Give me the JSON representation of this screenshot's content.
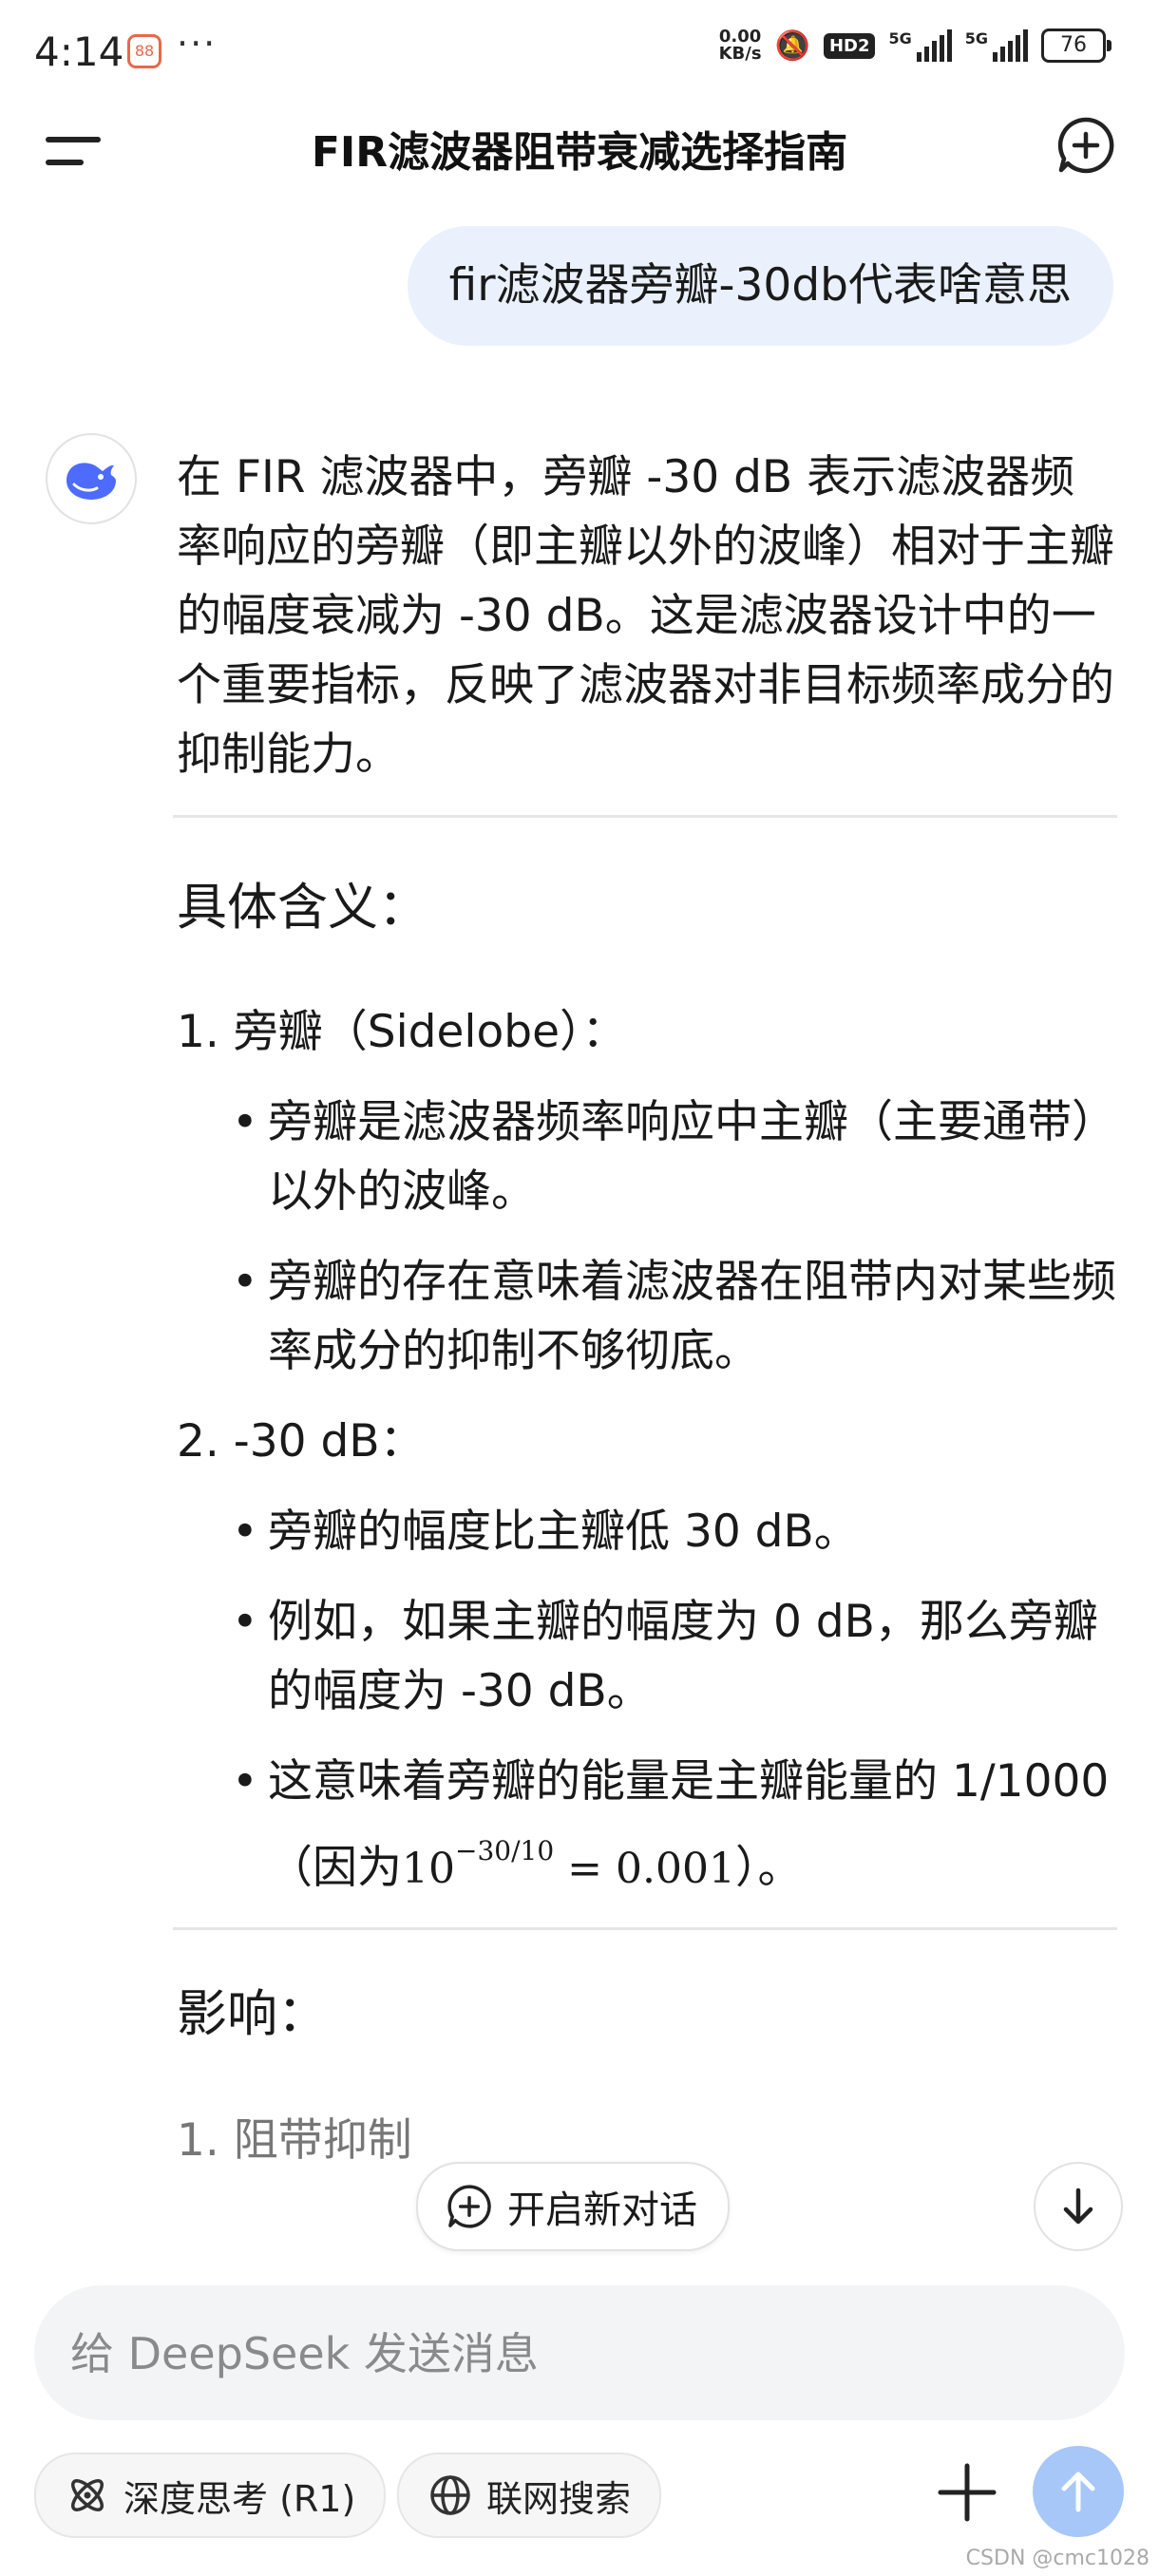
{
  "status_bar": {
    "time": "4:14",
    "app_badge": "88",
    "more": "···",
    "speed_value": "0.00",
    "speed_unit": "KB/s",
    "hd": "HD2",
    "net1": "5G",
    "net2": "5G",
    "battery": "76"
  },
  "header": {
    "title": "FIR滤波器阻带衰减选择指南"
  },
  "user_message": "fir滤波器旁瓣-30db代表啥意思",
  "answer": {
    "intro": "在 FIR 滤波器中，旁瓣 -30 dB 表示滤波器频率响应的旁瓣（即主瓣以外的波峰）相对于主瓣的幅度衰减为 -30 dB。这是滤波器设计中的一个重要指标，反映了滤波器对非目标频率成分的抑制能力。",
    "section1_title": "具体含义：",
    "item1_title": "1. 旁瓣（Sidelobe）：",
    "item1_bullets": [
      "旁瓣是滤波器频率响应中主瓣（主要通带）以外的波峰。",
      "旁瓣的存在意味着滤波器在阻带内对某些频率成分的抑制不够彻底。"
    ],
    "item2_title": "2. -30 dB：",
    "item2_bullets": [
      "旁瓣的幅度比主瓣低 30 dB。",
      "例如，如果主瓣的幅度为 0 dB，那么旁瓣的幅度为 -30 dB。"
    ],
    "item2_bullet3_text": "这意味着旁瓣的能量是主瓣能量的 1/1000（因为",
    "item2_bullet3_math_base": "10",
    "item2_bullet3_math_exp": "−30/10",
    "item2_bullet3_math_rest": " = 0.001",
    "item2_bullet3_tail": "）。",
    "section2_title": "影响：",
    "item3_title_partial": "1. 阻带抑制"
  },
  "floating": {
    "new_dialog": "开启新对话"
  },
  "input": {
    "placeholder": "给 DeepSeek 发送消息"
  },
  "toolbar": {
    "deep_think": "深度思考 (R1)",
    "web_search": "联网搜索"
  },
  "watermark": "CSDN @cmc1028",
  "colors": {
    "accent": "#4d6bfe",
    "bubble": "#eaf1fd",
    "send_disabled": "#a7c7f8"
  }
}
